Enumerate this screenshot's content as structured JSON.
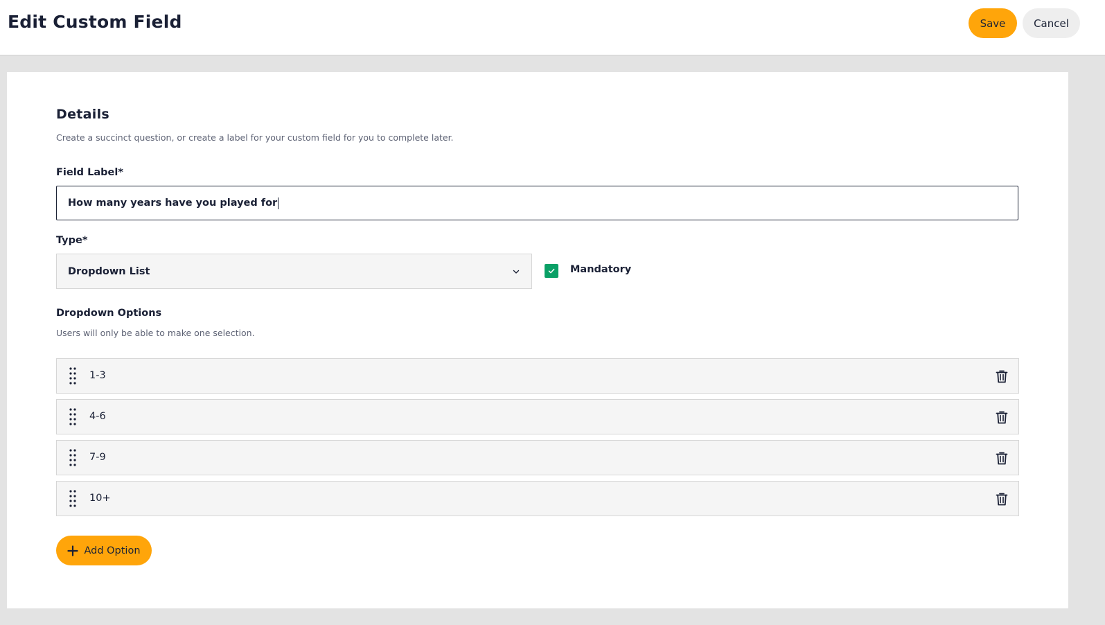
{
  "header": {
    "title": "Edit Custom Field",
    "save_label": "Save",
    "cancel_label": "Cancel"
  },
  "details": {
    "title": "Details",
    "description": "Create a succinct question, or create a label for your custom field for you to complete later."
  },
  "field_label": {
    "label": "Field Label*",
    "value": "How many years have you played for"
  },
  "type": {
    "label": "Type*",
    "selected": "Dropdown List"
  },
  "mandatory": {
    "label": "Mandatory",
    "checked": true
  },
  "dropdown_options": {
    "title": "Dropdown Options",
    "description": "Users will only be able to make one selection.",
    "items": [
      {
        "label": "1-3"
      },
      {
        "label": "4-6"
      },
      {
        "label": "7-9"
      },
      {
        "label": "10+"
      }
    ],
    "add_label": "Add Option"
  },
  "icons": {
    "drag": "drag-handle-icon",
    "delete": "trash-icon",
    "add": "plus-icon",
    "select": "chevron-down-icon",
    "check": "check-icon"
  },
  "colors": {
    "accent": "#ffa50a",
    "checkbox": "#0aa066",
    "text": "#1a2035"
  }
}
